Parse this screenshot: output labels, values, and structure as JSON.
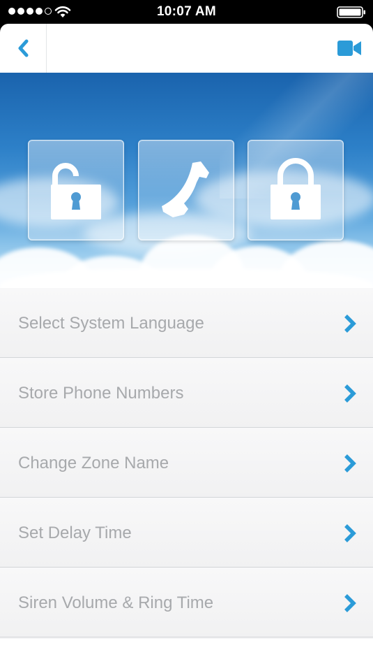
{
  "status_bar": {
    "time": "10:07 AM",
    "signal_dots": 5,
    "signal_filled": 4,
    "icons": [
      "wifi-icon",
      "battery-icon"
    ]
  },
  "nav": {
    "back_icon": "chevron-left-icon",
    "action_icon": "video-camera-icon"
  },
  "colors": {
    "accent": "#2b9bd8",
    "menu_text": "#a7a9ac",
    "sky_top": "#1a63ad"
  },
  "quick_actions": [
    {
      "icon": "unlock-icon"
    },
    {
      "icon": "phone-icon"
    },
    {
      "icon": "lock-icon"
    }
  ],
  "menu": {
    "items": [
      {
        "label": "Select System Language"
      },
      {
        "label": "Store Phone Numbers"
      },
      {
        "label": "Change Zone Name"
      },
      {
        "label": "Set Delay Time"
      },
      {
        "label": "Siren Volume & Ring Time"
      }
    ]
  }
}
